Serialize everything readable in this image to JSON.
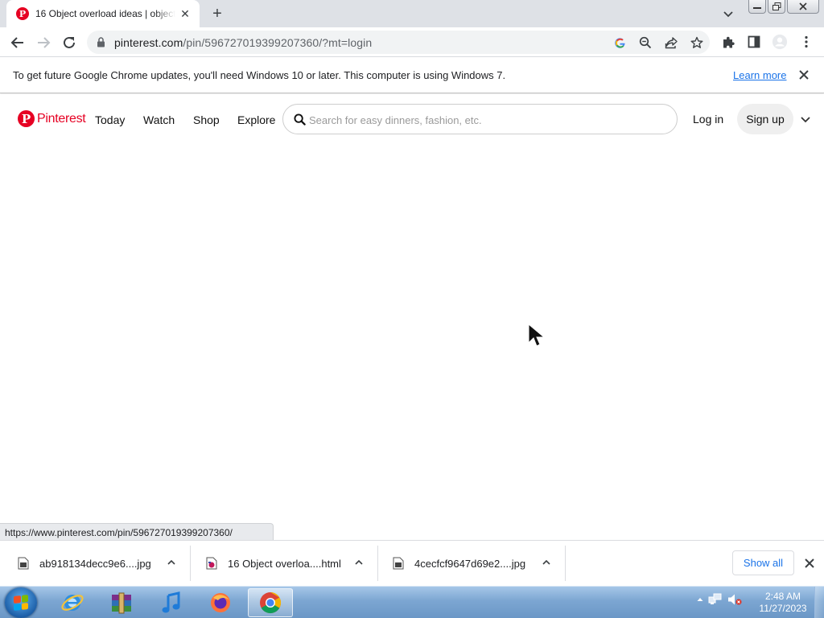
{
  "browser": {
    "tab": {
      "title": "16 Object overload ideas | object"
    },
    "address": {
      "host": "pinterest.com",
      "path": "/pin/596727019399207360/?mt=login"
    }
  },
  "infobar": {
    "message": "To get future Google Chrome updates, you'll need Windows 10 or later. This computer is using Windows 7.",
    "learn_more": "Learn more"
  },
  "pinterest": {
    "logo_text": "Pinterest",
    "nav": [
      "Today",
      "Watch",
      "Shop",
      "Explore"
    ],
    "search_placeholder": "Search for easy dinners, fashion, etc.",
    "login": "Log in",
    "signup": "Sign up"
  },
  "status_url": "https://www.pinterest.com/pin/596727019399207360/",
  "downloads": {
    "items": [
      {
        "name": "ab918134decc9e6....jpg"
      },
      {
        "name": "16 Object overloa....html"
      },
      {
        "name": "4cecfcf9647d69e2....jpg"
      }
    ],
    "show_all": "Show all"
  },
  "taskbar": {
    "time": "2:48 AM",
    "date": "11/27/2023"
  },
  "colors": {
    "pinterest_red": "#e60023",
    "chrome_blue": "#1a73e8"
  }
}
